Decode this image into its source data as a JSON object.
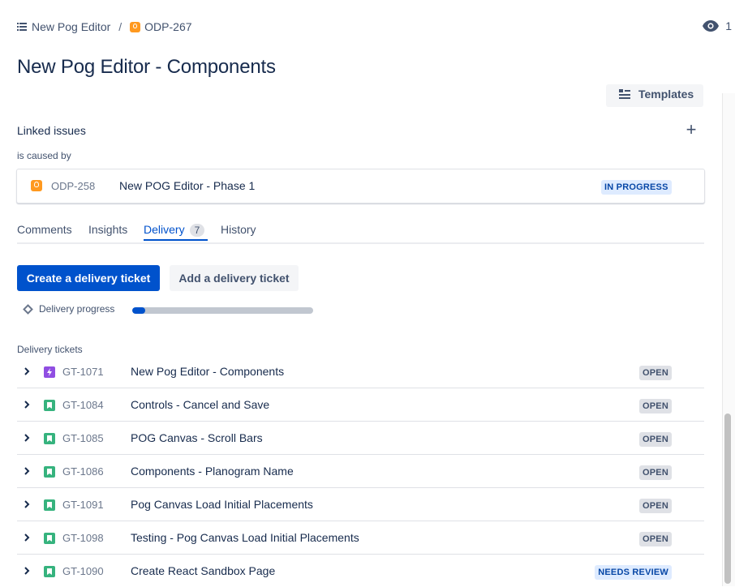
{
  "breadcrumb": {
    "project_icon": "list-icon",
    "project": "New Pog Editor",
    "separator": "/",
    "issue_icon": "idea-icon",
    "issue_key": "ODP-267"
  },
  "watchers": {
    "icon": "eye-icon",
    "count": "1"
  },
  "page_title": "New Pog Editor - Components",
  "templates_button": "Templates",
  "linked_issues": {
    "heading": "Linked issues",
    "add_icon": "plus-icon",
    "relation": "is caused by",
    "items": [
      {
        "key": "ODP-258",
        "summary": "New POG Editor - Phase 1",
        "status": "IN PROGRESS",
        "icon": "idea-icon"
      }
    ]
  },
  "tabs": [
    {
      "label": "Comments"
    },
    {
      "label": "Insights"
    },
    {
      "label": "Delivery",
      "count": "7",
      "active": true
    },
    {
      "label": "History"
    }
  ],
  "delivery": {
    "create_button": "Create a delivery ticket",
    "add_button": "Add a delivery ticket",
    "progress_label": "Delivery progress",
    "progress_fraction": 0.07,
    "tickets_label": "Delivery tickets",
    "tickets": [
      {
        "key": "GT-1071",
        "summary": "New Pog Editor - Components",
        "status": "OPEN",
        "type_icon": "epic-icon"
      },
      {
        "key": "GT-1084",
        "summary": "Controls - Cancel and Save",
        "status": "OPEN",
        "type_icon": "story-icon"
      },
      {
        "key": "GT-1085",
        "summary": "POG Canvas - Scroll Bars",
        "status": "OPEN",
        "type_icon": "story-icon"
      },
      {
        "key": "GT-1086",
        "summary": "Components - Planogram Name",
        "status": "OPEN",
        "type_icon": "story-icon"
      },
      {
        "key": "GT-1091",
        "summary": "Pog Canvas Load Initial Placements",
        "status": "OPEN",
        "type_icon": "story-icon"
      },
      {
        "key": "GT-1098",
        "summary": "Testing - Pog Canvas Load Initial Placements",
        "status": "OPEN",
        "type_icon": "story-icon"
      },
      {
        "key": "GT-1090",
        "summary": "Create React Sandbox Page",
        "status": "NEEDS REVIEW",
        "type_icon": "story-icon"
      }
    ]
  },
  "colors": {
    "primary": "#0052cc",
    "idea_orange": "#ff991f",
    "epic_purple": "#904ee2",
    "story_green": "#36b37e",
    "status_blue_bg": "#deebff",
    "status_grey_bg": "#dfe1e6"
  }
}
